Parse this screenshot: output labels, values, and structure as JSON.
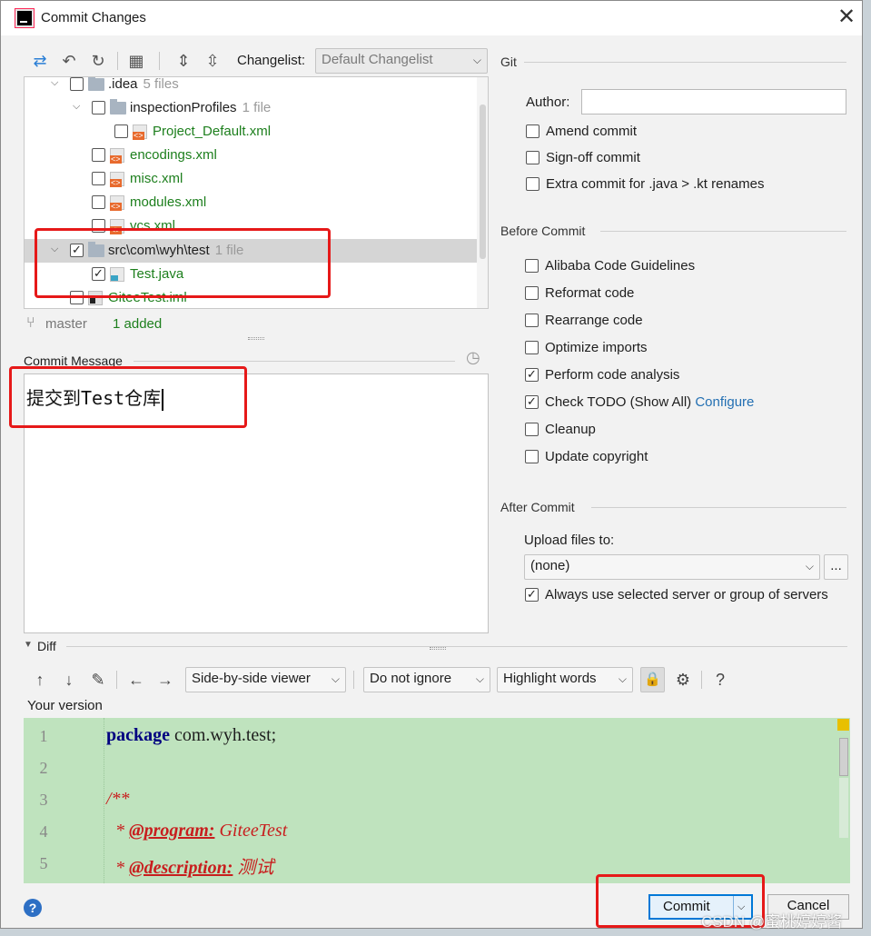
{
  "window": {
    "title": "Commit Changes",
    "close": "✕"
  },
  "toolbar": {
    "changelist_label": "Changelist:",
    "changelist_value": "Default Changelist"
  },
  "tree": {
    "rows": [
      {
        "name": ".idea",
        "count": "5 files"
      },
      {
        "name": "inspectionProfiles",
        "count": "1 file"
      },
      {
        "name": "Project_Default.xml"
      },
      {
        "name": "encodings.xml"
      },
      {
        "name": "misc.xml"
      },
      {
        "name": "modules.xml"
      },
      {
        "name": "vcs.xml"
      },
      {
        "name": "src\\com\\wyh\\test",
        "count": "1 file"
      },
      {
        "name": "Test.java"
      },
      {
        "name": "GiteeTest.iml"
      }
    ]
  },
  "status": {
    "branch": "master",
    "summary": "1 added"
  },
  "commit_message": {
    "label": "Commit Message",
    "text": "提交到Test仓库"
  },
  "git": {
    "title": "Git",
    "author_label": "Author:",
    "author_value": "",
    "amend": "Amend commit",
    "signoff": "Sign-off commit",
    "extra": "Extra commit for .java > .kt renames"
  },
  "before_commit": {
    "title": "Before Commit",
    "alibaba": "Alibaba Code Guidelines",
    "reformat": "Reformat code",
    "rearrange": "Rearrange code",
    "optimize": "Optimize imports",
    "analysis": "Perform code analysis",
    "todo": "Check TODO (Show All)",
    "todo_link": "Configure",
    "cleanup": "Cleanup",
    "copyright": "Update copyright"
  },
  "after_commit": {
    "title": "After Commit",
    "upload_label": "Upload files to:",
    "upload_value": "(none)",
    "ellipsis": "...",
    "always_use": "Always use selected server or group of servers"
  },
  "diff": {
    "title": "Diff",
    "viewer": "Side-by-side viewer",
    "ignore": "Do not ignore",
    "highlight": "Highlight words",
    "help": "?",
    "your_version": "Your version",
    "lines": [
      {
        "n": "1",
        "kw": "package",
        "rest": " com.wyh.test;"
      },
      {
        "n": "2",
        "text": ""
      },
      {
        "n": "3",
        "text": "/**"
      },
      {
        "n": "4",
        "tag": "@program:",
        "val": " GiteeTest"
      },
      {
        "n": "5",
        "tag": "@description:",
        "val": " 测试"
      }
    ]
  },
  "footer": {
    "commit": "Commit",
    "cancel": "Cancel",
    "help": "?",
    "watermark": "CSDN @蜜桃婷婷酱"
  },
  "colors": {
    "accent": "#0078d7",
    "highlight_box": "#e61919",
    "added_line": "#bfe3be",
    "link": "#2470b3"
  }
}
